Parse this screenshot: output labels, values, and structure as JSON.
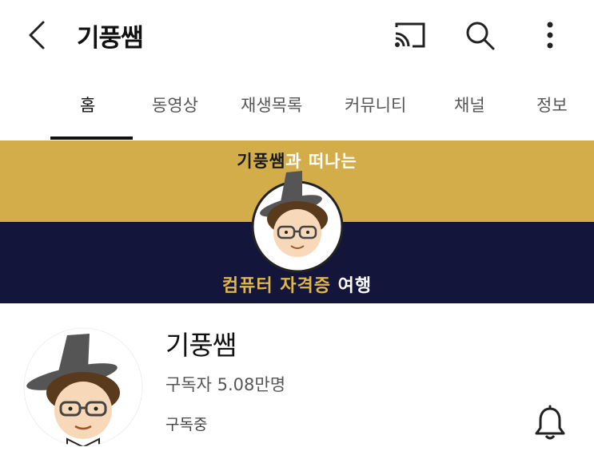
{
  "header": {
    "title": "기풍쌤",
    "icons": [
      "back-arrow-icon",
      "cast-icon",
      "search-icon",
      "more-vertical-icon"
    ]
  },
  "tabs": [
    {
      "label": "홈",
      "active": true
    },
    {
      "label": "동영상",
      "active": false
    },
    {
      "label": "재생목록",
      "active": false
    },
    {
      "label": "커뮤니티",
      "active": false
    },
    {
      "label": "채널",
      "active": false
    },
    {
      "label": "정보",
      "active": false
    }
  ],
  "banner": {
    "line1_part1": "기풍쌤",
    "line1_part2": "과 떠나는",
    "line2_part1": "컴퓨터 자격증",
    "line2_part2": " 여행",
    "colors": {
      "gold": "#d3ad49",
      "navy": "#13163a"
    }
  },
  "channel": {
    "name": "기풍쌤",
    "subscribers": "구독자 5.08만명",
    "subscribed_label": "구독중",
    "bell_icon": "notification-bell-icon"
  }
}
